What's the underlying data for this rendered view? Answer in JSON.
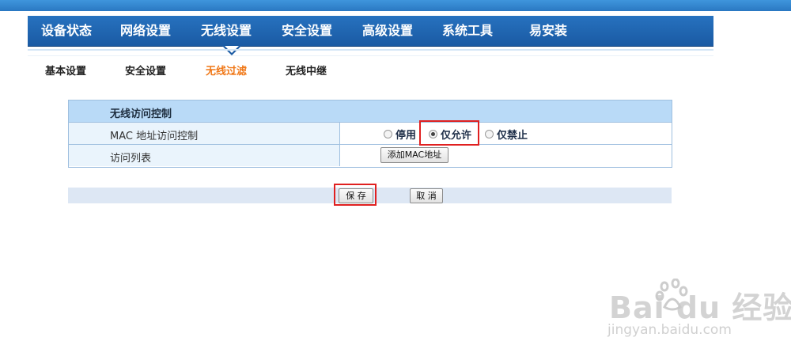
{
  "nav": {
    "items": [
      {
        "label": "设备状态"
      },
      {
        "label": "网络设置"
      },
      {
        "label": "无线设置",
        "active": true
      },
      {
        "label": "安全设置"
      },
      {
        "label": "高级设置"
      },
      {
        "label": "系统工具"
      },
      {
        "label": "易安装"
      }
    ]
  },
  "subnav": {
    "items": [
      {
        "label": "基本设置"
      },
      {
        "label": "安全设置"
      },
      {
        "label": "无线过滤",
        "active": true
      },
      {
        "label": "无线中继"
      }
    ]
  },
  "panel": {
    "title": "无线访问控制",
    "mac_control": {
      "label": "MAC 地址访问控制",
      "options": [
        {
          "label": "停用",
          "checked": false
        },
        {
          "label": "仅允许",
          "checked": true
        },
        {
          "label": "仅禁止",
          "checked": false
        }
      ]
    },
    "access_list": {
      "label": "访问列表",
      "add_button": "添加MAC地址"
    }
  },
  "footer": {
    "save_label": "保 存",
    "cancel_label": "取 消"
  },
  "watermark": {
    "logo_text": "Bai du 经验",
    "url": "jingyan.baidu.com"
  },
  "colors": {
    "nav_bg": "#1a5aa3",
    "active_sub": "#f07818",
    "highlight": "#e02020",
    "header_bg": "#b9daf7"
  }
}
